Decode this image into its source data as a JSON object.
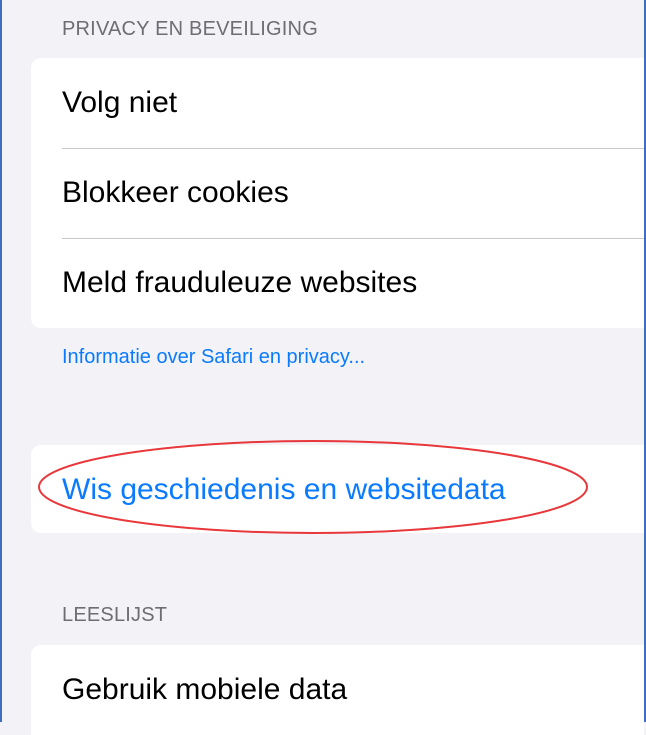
{
  "privacy_section": {
    "header": "PRIVACY EN BEVEILIGING",
    "rows": [
      {
        "label": "Volg niet"
      },
      {
        "label": "Blokkeer cookies"
      },
      {
        "label": "Meld frauduleuze websites"
      }
    ],
    "info_link": "Informatie over Safari en privacy..."
  },
  "clear_history": {
    "label": "Wis geschiedenis en websitedata"
  },
  "reading_list_section": {
    "header": "LEESLIJST",
    "rows": [
      {
        "label": "Gebruik mobiele data"
      }
    ]
  },
  "colors": {
    "background": "#f2f2f7",
    "link_blue": "#0a7aff",
    "annotation_red": "#e8383b",
    "frame_blue": "#3d6fbe"
  }
}
